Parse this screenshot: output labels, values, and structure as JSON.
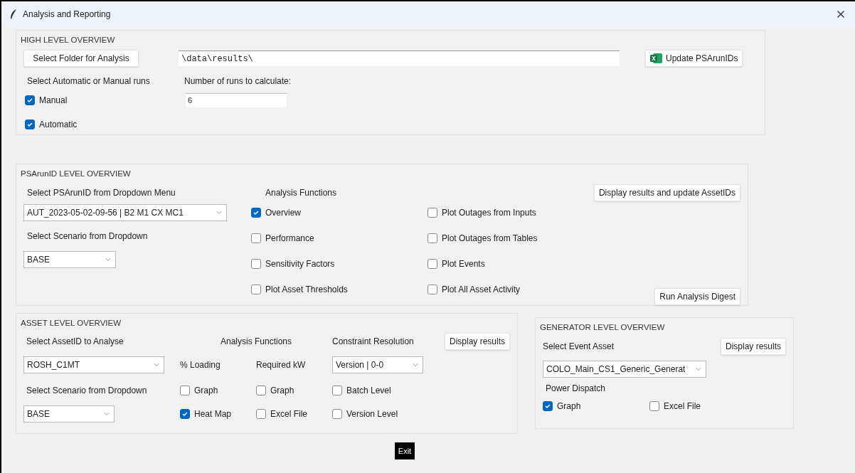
{
  "window": {
    "title": "Analysis and Reporting"
  },
  "high_level": {
    "title": "HIGH LEVEL OVERVIEW",
    "folder_button": "Select Folder for Analysis",
    "folder_path": "\\data\\results\\",
    "update_button": "Update PSArunIDs",
    "mode_label": "Select Automatic or Manual runs",
    "runs_label": "Number of runs to calculate:",
    "runs_value": "6",
    "modes": [
      {
        "label": "Manual",
        "checked": true
      },
      {
        "label": "Automatic",
        "checked": true
      }
    ]
  },
  "psarun": {
    "title": "PSArunID LEVEL OVERVIEW",
    "select_label": "Select PSArunID from Dropdown Menu",
    "run_dropdown": "AUT_2023-05-02-09-56 | B2 M1 CX MC1",
    "scenario_label": "Select Scenario from Dropdown",
    "scenario_dropdown": "BASE",
    "functions_label": "Analysis Functions",
    "display_button": "Display results and update AssetIDs",
    "digest_button": "Run Analysis Digest",
    "functions": [
      {
        "label": "Overview",
        "checked": true
      },
      {
        "label": "Performance",
        "checked": false
      },
      {
        "label": "Sensitivity Factors",
        "checked": false
      },
      {
        "label": "Plot Asset Thresholds",
        "checked": false
      },
      {
        "label": "Plot Outages from Inputs",
        "checked": false
      },
      {
        "label": "Plot Outages from Tables",
        "checked": false
      },
      {
        "label": "Plot Events",
        "checked": false
      },
      {
        "label": "Plot All Asset Activity",
        "checked": false
      }
    ]
  },
  "asset": {
    "title": "ASSET LEVEL OVERVIEW",
    "select_label": "Select AssetID to Analyse",
    "asset_dropdown": "ROSH_C1MT",
    "scenario_label": "Select Scenario from Dropdown",
    "scenario_dropdown": "BASE",
    "functions_label": "Analysis Functions",
    "display_button": "Display results",
    "columns": [
      {
        "heading": "% Loading",
        "options": [
          {
            "label": "Graph",
            "checked": false
          },
          {
            "label": "Heat Map",
            "checked": true
          }
        ]
      },
      {
        "heading": "Required kW",
        "options": [
          {
            "label": "Graph",
            "checked": false
          },
          {
            "label": "Excel File",
            "checked": false
          }
        ]
      }
    ],
    "constraint": {
      "title": "Constraint Resolution",
      "dropdown": "Version | 0-0",
      "options": [
        {
          "label": "Batch Level",
          "checked": false
        },
        {
          "label": "Version Level",
          "checked": false
        }
      ]
    }
  },
  "generator": {
    "title": "GENERATOR LEVEL OVERVIEW",
    "select_label": "Select Event Asset",
    "display_button": "Display results",
    "dropdown": "COLO_Main_CS1_Generic_Generat",
    "dispatch_label": "Power Dispatch",
    "options": [
      {
        "label": "Graph",
        "checked": true
      },
      {
        "label": "Excel File",
        "checked": false
      }
    ]
  },
  "exit_button": "Exit"
}
